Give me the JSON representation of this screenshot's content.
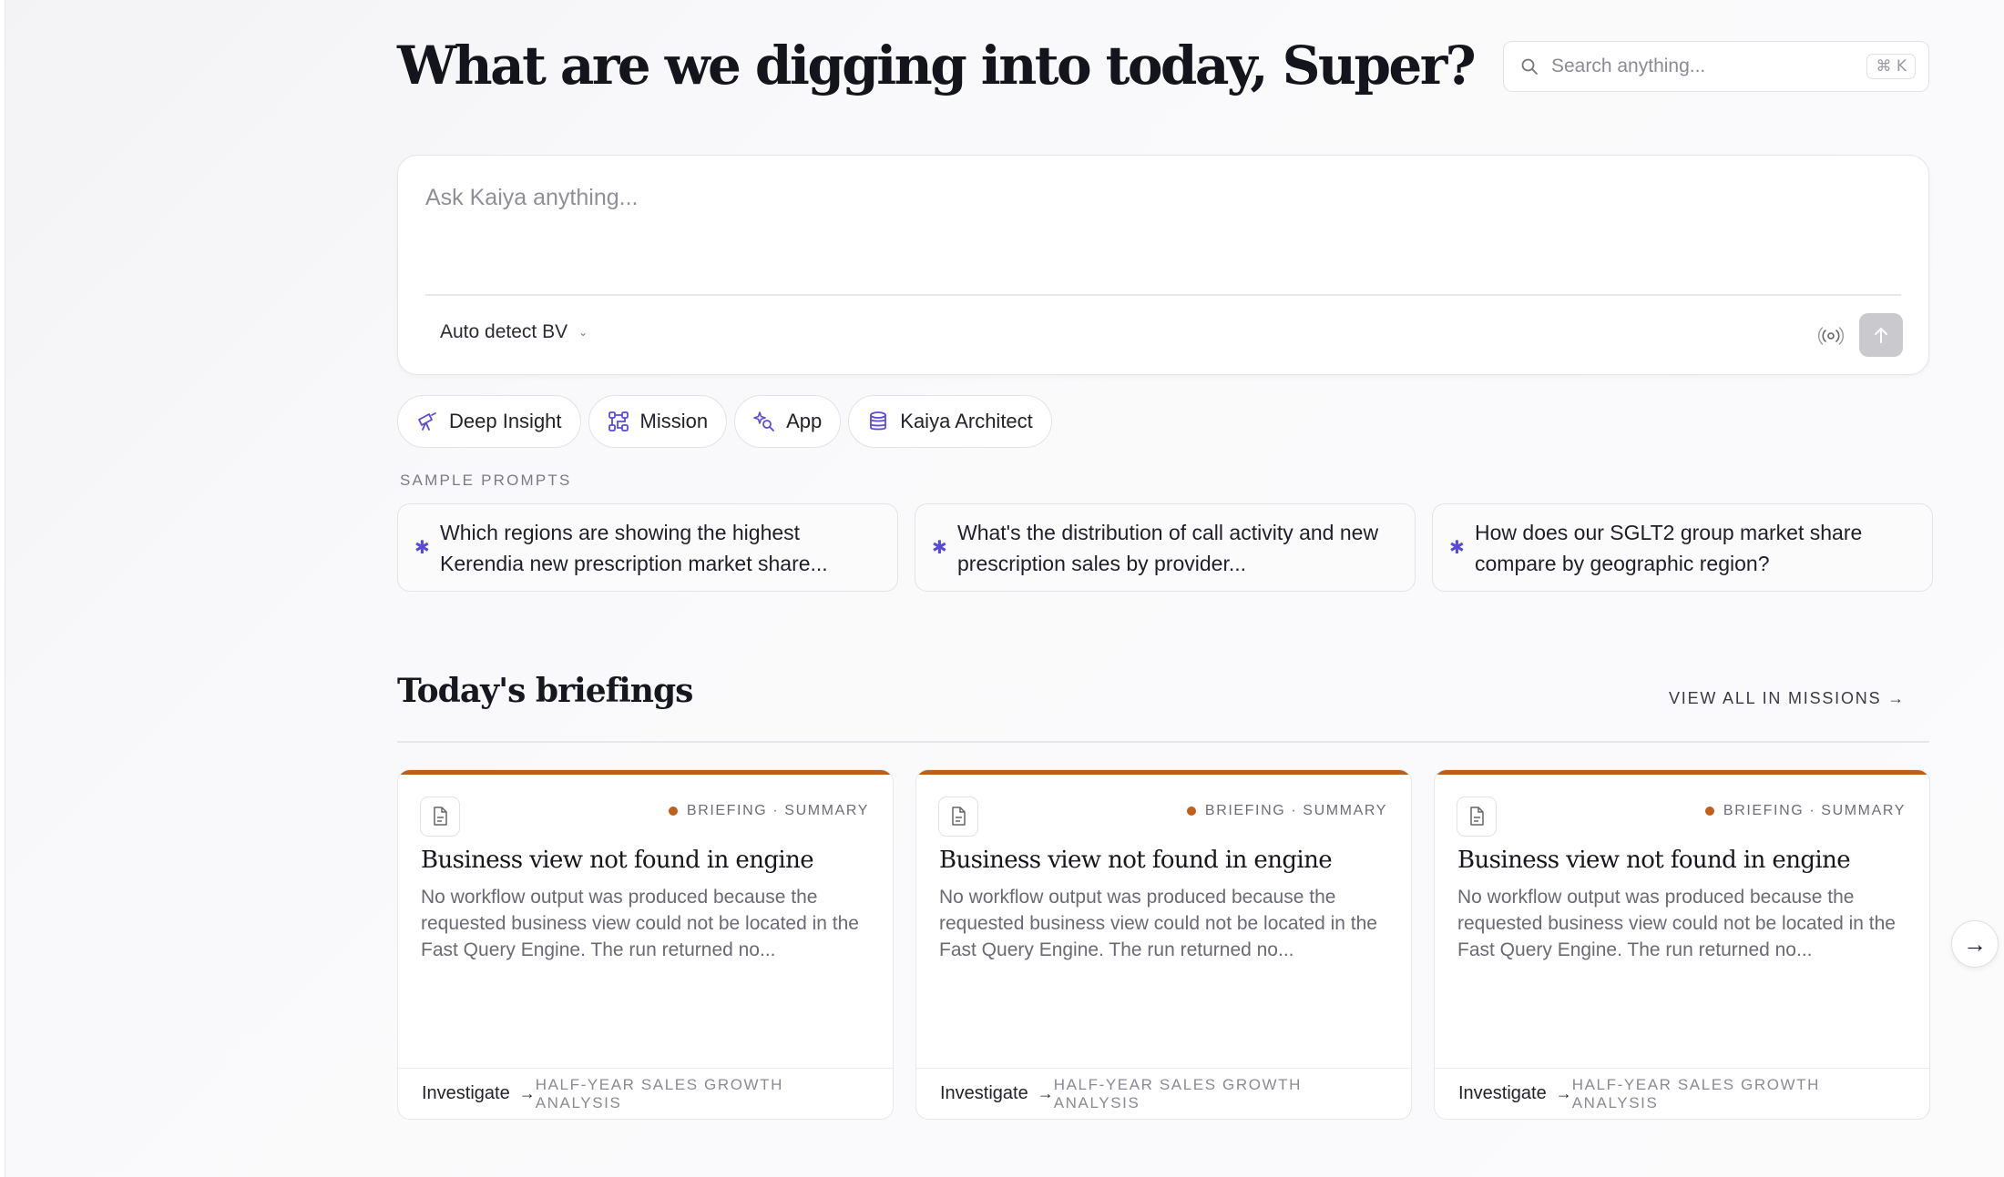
{
  "header": {
    "greeting": "What are we digging into today, Super?",
    "search_placeholder": "Search anything...",
    "search_shortcut": "⌘ K"
  },
  "composer": {
    "placeholder": "Ask Kaiya anything...",
    "bv_select_label": "Auto detect BV"
  },
  "modes": [
    {
      "label": "Deep Insight",
      "icon": "telescope-icon"
    },
    {
      "label": "Mission",
      "icon": "workflow-icon"
    },
    {
      "label": "App",
      "icon": "sparkle-search-icon"
    },
    {
      "label": "Kaiya Architect",
      "icon": "database-icon"
    }
  ],
  "sample_prompts": {
    "title": "SAMPLE PROMPTS",
    "items": [
      "Which regions are showing the highest Kerendia new prescription market share...",
      "What's the distribution of call activity and new prescription sales by provider...",
      "How does our SGLT2 group market share compare by geographic region?"
    ]
  },
  "briefings": {
    "title": "Today's briefings",
    "view_all": "VIEW ALL IN MISSIONS →",
    "accent_color": "#b8601f",
    "cards": [
      {
        "tag": "BRIEFING · SUMMARY",
        "title": "Business view not found in engine",
        "body": "No workflow output was produced because the requested business view could not be located in the Fast Query Engine. The run returned no...",
        "action": "Investigate",
        "meta": "HALF-YEAR SALES GROWTH ANALYSIS"
      },
      {
        "tag": "BRIEFING · SUMMARY",
        "title": "Business view not found in engine",
        "body": "No workflow output was produced because the requested business view could not be located in the Fast Query Engine. The run returned no...",
        "action": "Investigate",
        "meta": "HALF-YEAR SALES GROWTH ANALYSIS"
      },
      {
        "tag": "BRIEFING · SUMMARY",
        "title": "Business view not found in engine",
        "body": "No workflow output was produced because the requested business view could not be located in the Fast Query Engine. The run returned no...",
        "action": "Investigate",
        "meta": "HALF-YEAR SALES GROWTH ANALYSIS"
      }
    ]
  }
}
